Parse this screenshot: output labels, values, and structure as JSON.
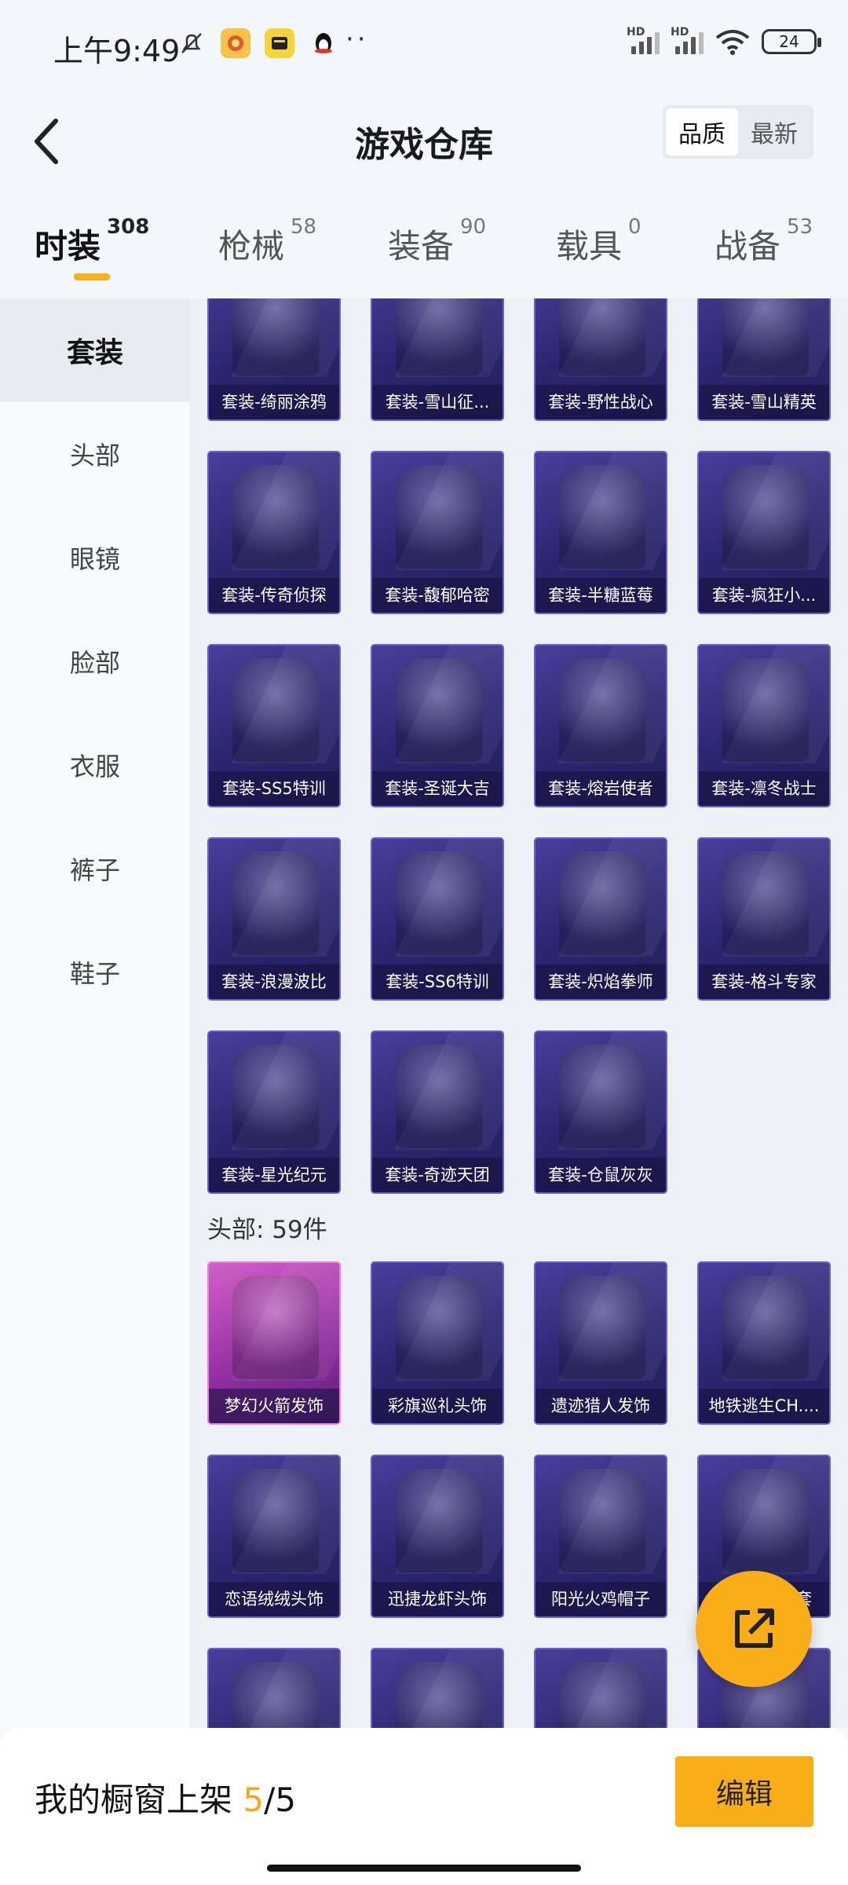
{
  "status_bar": {
    "time": "上午9:49",
    "signal_label_1": "HD",
    "signal_label_2": "HD",
    "battery": "24"
  },
  "header": {
    "title": "游戏仓库",
    "sort_options": [
      "品质",
      "最新"
    ],
    "sort_selected": "品质"
  },
  "tabs": [
    {
      "label": "时装",
      "count": "308",
      "active": true
    },
    {
      "label": "枪械",
      "count": "58"
    },
    {
      "label": "装备",
      "count": "90"
    },
    {
      "label": "载具",
      "count": "0"
    },
    {
      "label": "战备",
      "count": "53"
    }
  ],
  "sidebar": {
    "items": [
      "套装",
      "头部",
      "眼镜",
      "脸部",
      "衣服",
      "裤子",
      "鞋子"
    ],
    "active": "套装"
  },
  "sets": [
    "套装-绮丽涂鸦",
    "套装-雪山征...",
    "套装-野性战心",
    "套装-雪山精英",
    "套装-传奇侦探",
    "套装-馥郁哈密",
    "套装-半糖蓝莓",
    "套装-疯狂小...",
    "套装-SS5特训",
    "套装-圣诞大吉",
    "套装-熔岩使者",
    "套装-凛冬战士",
    "套装-浪漫波比",
    "套装-SS6特训",
    "套装-炽焰拳师",
    "套装-格斗专家",
    "套装-星光纪元",
    "套装-奇迹天团",
    "套装-仓鼠灰灰"
  ],
  "head_section": {
    "title": "头部: 59件",
    "items": [
      "梦幻火箭发饰",
      "彩旗巡礼头饰",
      "遗迹猎人发饰",
      "地铁逃生CH....",
      "恋语绒绒头饰",
      "迅捷龙虾头饰",
      "阳光火鸡帽子",
      "套",
      "",
      "",
      "",
      ""
    ]
  },
  "bottom_bar": {
    "label": "我的橱窗上架",
    "current": "5",
    "separator": "/",
    "total": "5",
    "edit_label": "编辑"
  },
  "colors": {
    "accent": "#f9ad16",
    "card_bg": "#2c2670",
    "card_highlight": "#d35fc8"
  }
}
